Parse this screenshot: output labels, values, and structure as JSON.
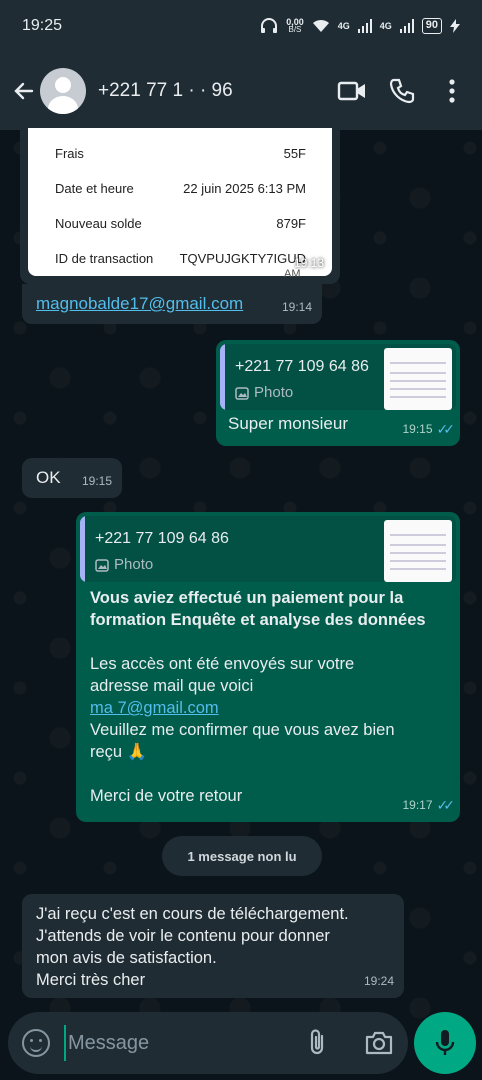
{
  "status_bar": {
    "time": "19:25",
    "net_speed_value": "0,00",
    "net_speed_unit": "B/S",
    "network_1": "4G",
    "network_2": "4G",
    "battery": "90"
  },
  "header": {
    "contact_name": "+221 77 1   ·  · 96",
    "icons": [
      "back-arrow-icon",
      "video-call-icon",
      "phone-icon",
      "more-options-icon"
    ]
  },
  "receipt": {
    "rows": [
      {
        "label": "Frais",
        "value": "55F"
      },
      {
        "label": "Date et heure",
        "value": "22 juin 2025 6:13 PM"
      },
      {
        "label": "Nouveau solde",
        "value": "879F"
      },
      {
        "label": "ID de transaction",
        "value": "TQVPUJGKTY7IGUD"
      }
    ],
    "am_suffix": "AM",
    "time": "19:13"
  },
  "messages": [
    {
      "id": "m1",
      "direction": "in",
      "text": "magnobalde17@gmail.com",
      "time": "19:14"
    },
    {
      "id": "m2",
      "direction": "out",
      "quote_name": "+221 77 109 64 86",
      "quote_type": "Photo",
      "text": "Super monsieur",
      "time": "19:15"
    },
    {
      "id": "m3",
      "direction": "in",
      "text": "OK",
      "time": "19:15"
    },
    {
      "id": "m4",
      "direction": "out",
      "quote_name": "+221 77 109 64 86",
      "quote_type": "Photo",
      "bold_text": "Vous aviez effectué un paiement pour la formation Enquête et analyse des données",
      "line1": "Les accès ont été envoyés sur votre",
      "line2": "adresse mail que voici",
      "email": "ma            7@gmail.com",
      "line3": "Veuillez me confirmer que vous avez bien",
      "line4": "reçu 🙏",
      "line5": "Merci de votre retour",
      "time": "19:17"
    },
    {
      "id": "m5",
      "direction": "in",
      "lines": [
        "J'ai reçu c'est en cours de téléchargement.",
        "J'attends de voir le contenu pour donner",
        "mon avis de satisfaction.",
        "Merci très cher"
      ],
      "time": "19:24"
    }
  ],
  "unread_banner": "1 message non lu",
  "composer": {
    "placeholder": "Message",
    "icons": [
      "emoji-icon",
      "attach-icon",
      "camera-icon",
      "mic-icon"
    ]
  },
  "colors": {
    "incoming_bubble": "#202c33",
    "outgoing_bubble": "#005c4b",
    "accent": "#00a884",
    "link": "#53bdeb"
  }
}
